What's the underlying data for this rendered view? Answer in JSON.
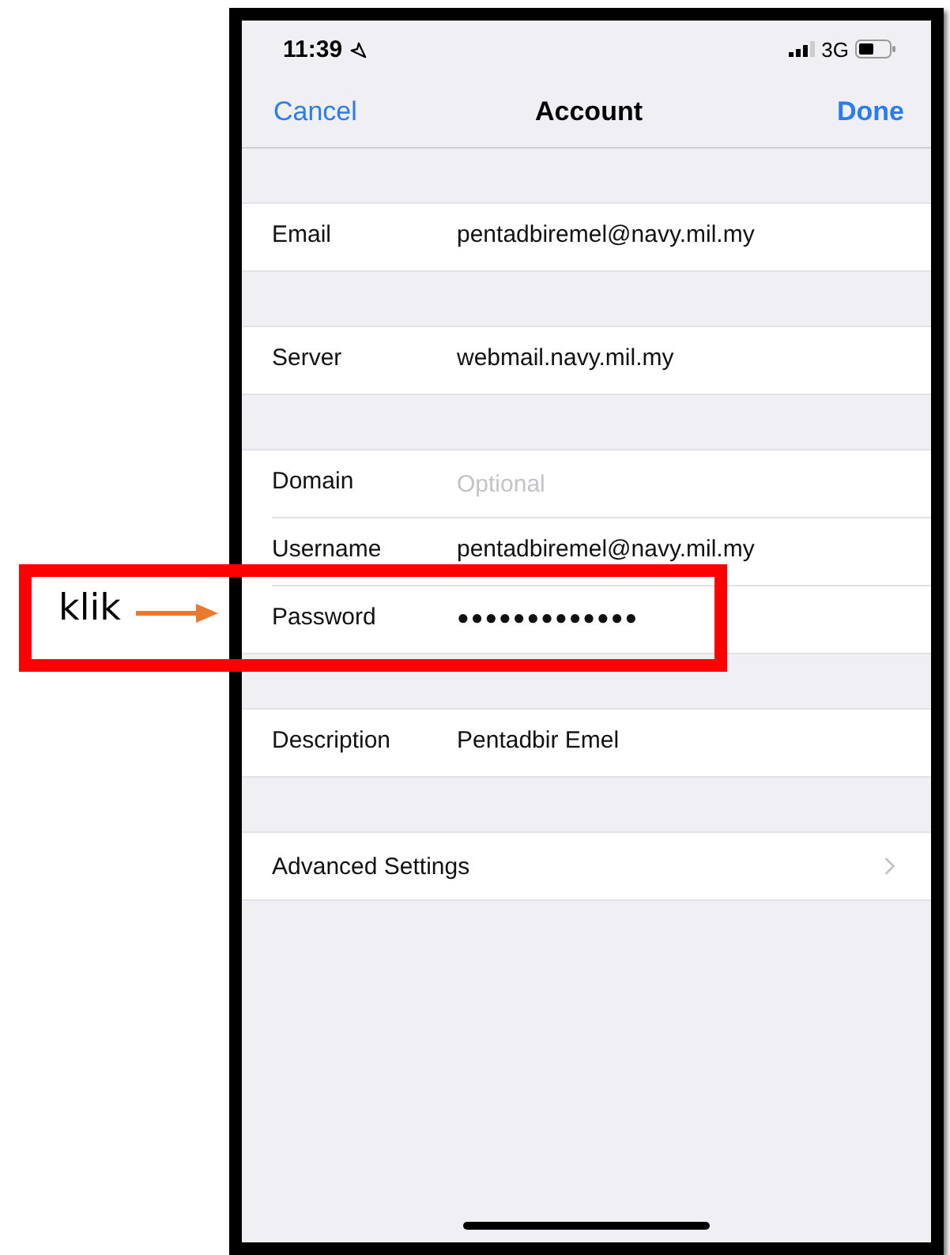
{
  "status_bar": {
    "time": "11:39",
    "network": "3G"
  },
  "nav": {
    "cancel": "Cancel",
    "title": "Account",
    "done": "Done"
  },
  "groups": [
    {
      "rows": [
        {
          "kind": "text",
          "label": "Email",
          "value": "pentadbiremel@navy.mil.my"
        }
      ]
    },
    {
      "rows": [
        {
          "kind": "text",
          "label": "Server",
          "value": "webmail.navy.mil.my"
        }
      ]
    },
    {
      "rows": [
        {
          "kind": "empty",
          "label": "Domain",
          "placeholder": "Optional"
        },
        {
          "kind": "text",
          "label": "Username",
          "value": "pentadbiremel@navy.mil.my"
        },
        {
          "kind": "password",
          "label": "Password",
          "value": "●●●●●●●●●●●●●"
        }
      ]
    },
    {
      "rows": [
        {
          "kind": "text",
          "label": "Description",
          "value": "Pentadbir Emel"
        }
      ]
    },
    {
      "rows": [
        {
          "kind": "link",
          "label": "Advanced Settings"
        }
      ]
    }
  ],
  "annotation": {
    "label": "klik"
  }
}
